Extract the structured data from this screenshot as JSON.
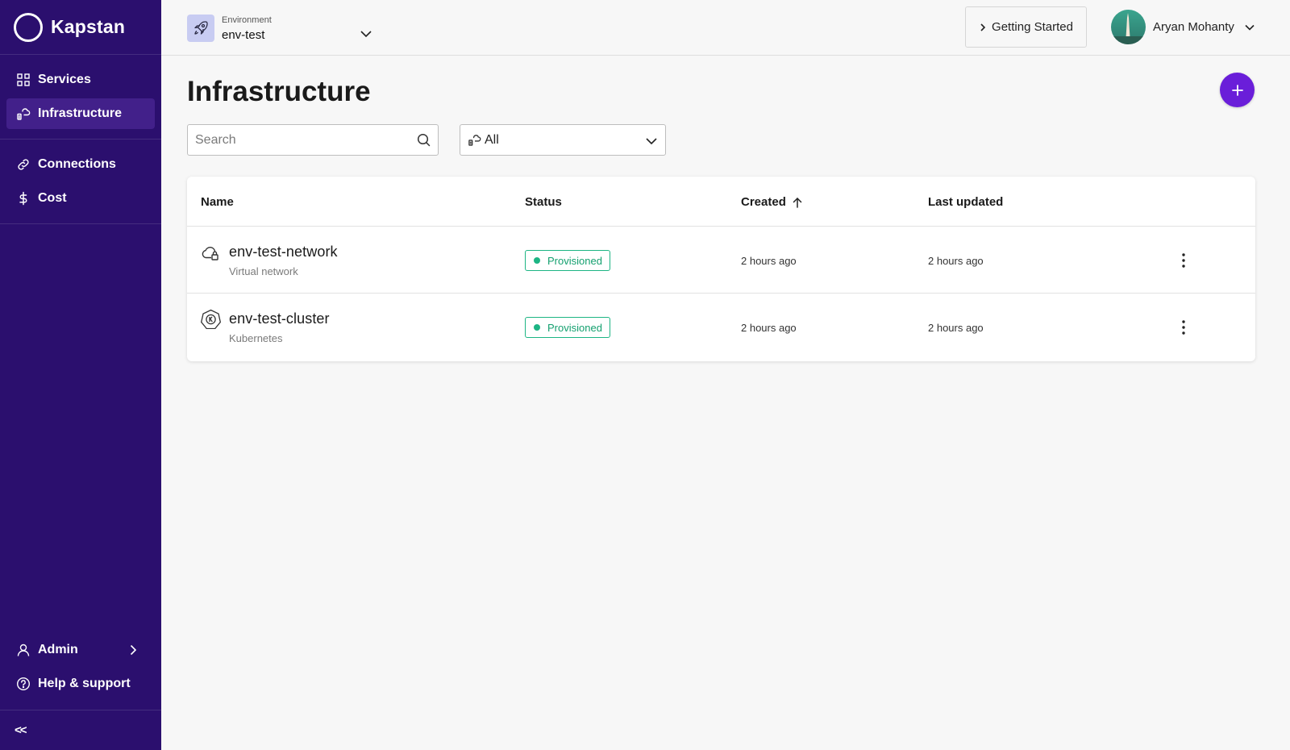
{
  "sidebar": {
    "brand": "Kapstan",
    "nav_primary": [
      {
        "label": "Services",
        "icon": "grid-icon"
      },
      {
        "label": "Infrastructure",
        "icon": "infrastructure-icon",
        "active": true
      }
    ],
    "nav_secondary": [
      {
        "label": "Connections",
        "icon": "link-icon"
      },
      {
        "label": "Cost",
        "icon": "dollar-icon"
      }
    ],
    "nav_bottom": [
      {
        "label": "Admin",
        "icon": "user-icon"
      },
      {
        "label": "Help & support",
        "icon": "help-icon"
      }
    ],
    "collapse_label": "<<",
    "bg_color": "#2b0f6e",
    "active_color": "#42208a"
  },
  "topbar": {
    "env_caption": "Environment",
    "env_value": "env-test",
    "getting_started_label": "Getting Started",
    "user_name": "Aryan Mohanty"
  },
  "main": {
    "title": "Infrastructure",
    "search_placeholder": "Search",
    "filter_value": "All",
    "accent_color": "#6a1ed9"
  },
  "table": {
    "columns": {
      "name": "Name",
      "status": "Status",
      "created": "Created",
      "updated": "Last updated"
    },
    "rows": [
      {
        "name": "env-test-network",
        "type": "Virtual network",
        "icon": "cloud-lock-icon",
        "status": "Provisioned",
        "created": "2 hours ago",
        "updated": "2 hours ago"
      },
      {
        "name": "env-test-cluster",
        "type": "Kubernetes",
        "icon": "kubernetes-icon",
        "status": "Provisioned",
        "created": "2 hours ago",
        "updated": "2 hours ago"
      }
    ],
    "status_color": "#1db584"
  }
}
